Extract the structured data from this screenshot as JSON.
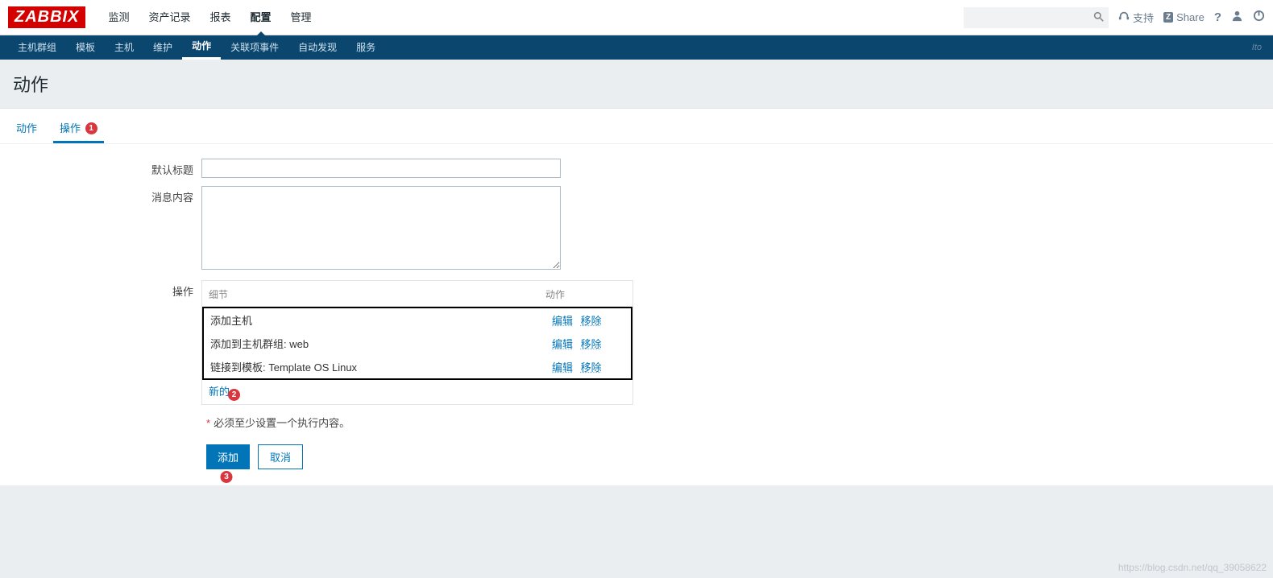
{
  "logo": "ZABBIX",
  "topMenu": [
    "监测",
    "资产记录",
    "报表",
    "配置",
    "管理"
  ],
  "topMenuActiveIndex": 3,
  "topRight": {
    "support": "支持",
    "share": "Share",
    "shareBadge": "Z"
  },
  "subMenu": [
    "主机群组",
    "模板",
    "主机",
    "维护",
    "动作",
    "关联项事件",
    "自动发现",
    "服务"
  ],
  "subMenuActiveIndex": 4,
  "subRightText": "Ito",
  "pageTitle": "动作",
  "tabs": [
    "动作",
    "操作"
  ],
  "tabActiveIndex": 1,
  "tabBadge": "1",
  "form": {
    "defaultSubjectLabel": "默认标题",
    "defaultSubjectValue": "",
    "messageLabel": "消息内容",
    "messageValue": "",
    "operationsLabel": "操作",
    "opsHeaderDetail": "细节",
    "opsHeaderAction": "动作",
    "opsRows": [
      {
        "detail": "添加主机",
        "edit": "编辑",
        "remove": "移除"
      },
      {
        "detail": "添加到主机群组: web",
        "edit": "编辑",
        "remove": "移除"
      },
      {
        "detail": "链接到模板: Template OS Linux",
        "edit": "编辑",
        "remove": "移除"
      }
    ],
    "newLink": "新的",
    "newBadge": "2",
    "hintAsterisk": "*",
    "hint": "必须至少设置一个执行内容。",
    "addButton": "添加",
    "addBadge": "3",
    "cancelButton": "取消"
  },
  "watermark": "https://blog.csdn.net/qq_39058622"
}
